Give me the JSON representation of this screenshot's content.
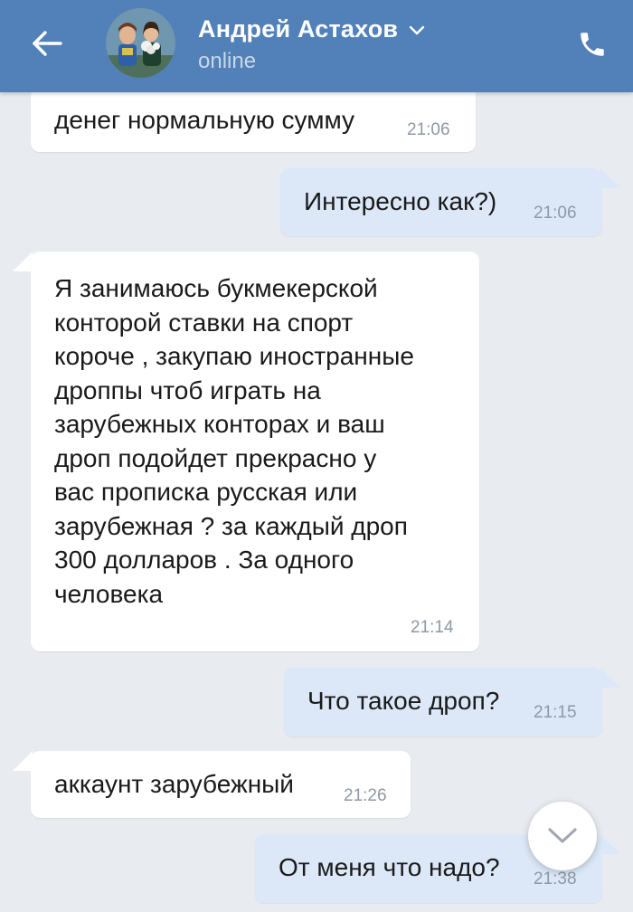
{
  "header": {
    "contact_name": "Андрей Астахов",
    "status": "online",
    "back_icon": "arrow-left-icon",
    "call_icon": "phone-icon",
    "background_color": "#5181b8"
  },
  "messages": [
    {
      "direction": "in",
      "text": "денег нормальную сумму",
      "time": "21:06"
    },
    {
      "direction": "out",
      "text": "Интересно как?)",
      "time": "21:06"
    },
    {
      "direction": "in",
      "text": "Я занимаюсь букмекерской\nконторой ставки на спорт\nкороче , закупаю иностранные\nдроппы чтоб играть на\nзарубежных конторах и ваш\nдроп подойдет прекрасно у\nвас прописка русская или\nзарубежная ? за каждый дроп\n300 долларов . За одного\nчеловека",
      "time": "21:14"
    },
    {
      "direction": "out",
      "text": "Что такое дроп?",
      "time": "21:15"
    },
    {
      "direction": "in",
      "text": "аккаунт зарубежный",
      "time": "21:26"
    },
    {
      "direction": "out",
      "text": "От меня что надо?",
      "time": "21:38"
    }
  ],
  "scroll_down_icon": "chevron-down-icon",
  "colors": {
    "incoming_bubble": "#ffffff",
    "outgoing_bubble": "#dce8f8",
    "background": "#e8ebf0",
    "timestamp": "#8e98a6"
  }
}
